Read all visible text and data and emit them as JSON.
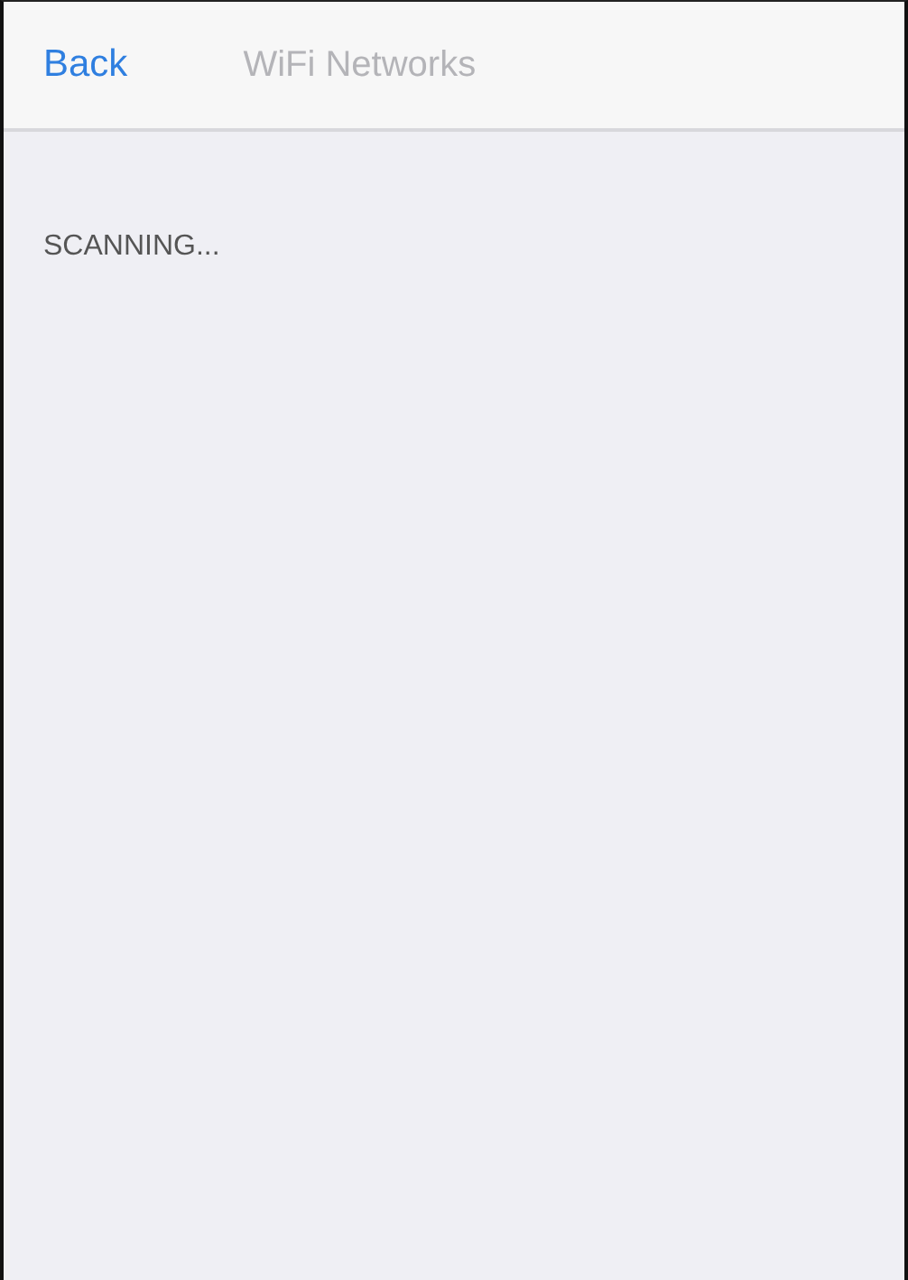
{
  "nav_bar": {
    "back": "Back",
    "title": "WiFi Networks"
  },
  "status": "SCANNING..."
}
